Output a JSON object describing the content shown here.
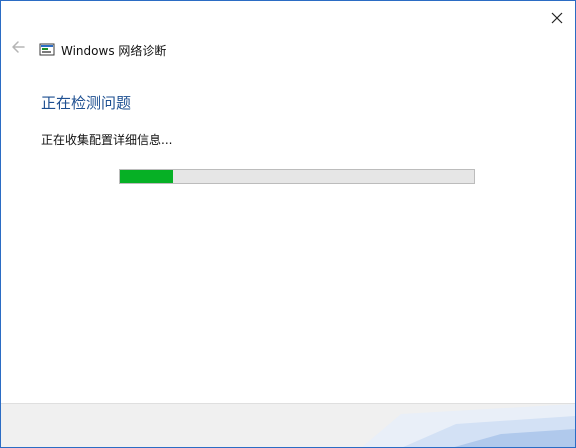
{
  "window": {
    "app_title": "Windows 网络诊断",
    "heading": "正在检测问题",
    "status_text": "正在收集配置详细信息...",
    "progress_fraction": 0.15
  },
  "icons": {
    "close": "close-icon",
    "back": "back-arrow-icon",
    "app": "network-diagnostics-icon"
  },
  "colors": {
    "heading": "#1d4f91",
    "progress_fill": "#06b025",
    "progress_track": "#e6e6e6",
    "window_border": "#2b6cc4"
  }
}
